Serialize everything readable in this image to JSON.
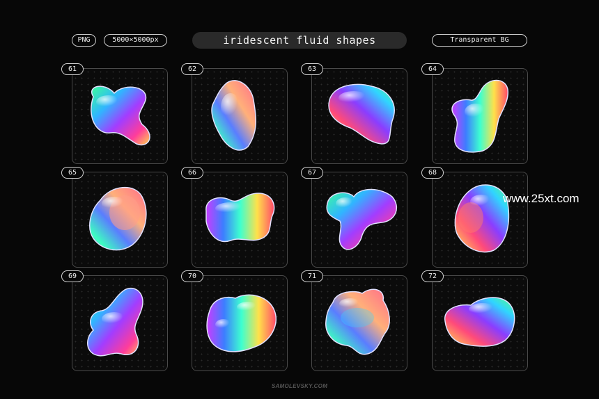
{
  "header": {
    "format_badge": "PNG",
    "size_badge": "5000×5000px",
    "title": "iridescent fluid shapes",
    "background_badge": "Transparent BG"
  },
  "cards": [
    {
      "number": "61"
    },
    {
      "number": "62"
    },
    {
      "number": "63"
    },
    {
      "number": "64"
    },
    {
      "number": "65"
    },
    {
      "number": "66"
    },
    {
      "number": "67"
    },
    {
      "number": "68"
    },
    {
      "number": "69"
    },
    {
      "number": "70"
    },
    {
      "number": "71"
    },
    {
      "number": "72"
    }
  ],
  "watermark": "www.25xt.com",
  "footer": "SAMOLEVSKY.COM",
  "colors": {
    "background": "#070707",
    "card_border": "#4a4a4a",
    "title_pill": "#2a2a2a",
    "iridescent": [
      "#ff3d7f",
      "#ff8a3d",
      "#ffe14a",
      "#3dff7a",
      "#30d5ff",
      "#3d5bff",
      "#b03dff"
    ]
  }
}
